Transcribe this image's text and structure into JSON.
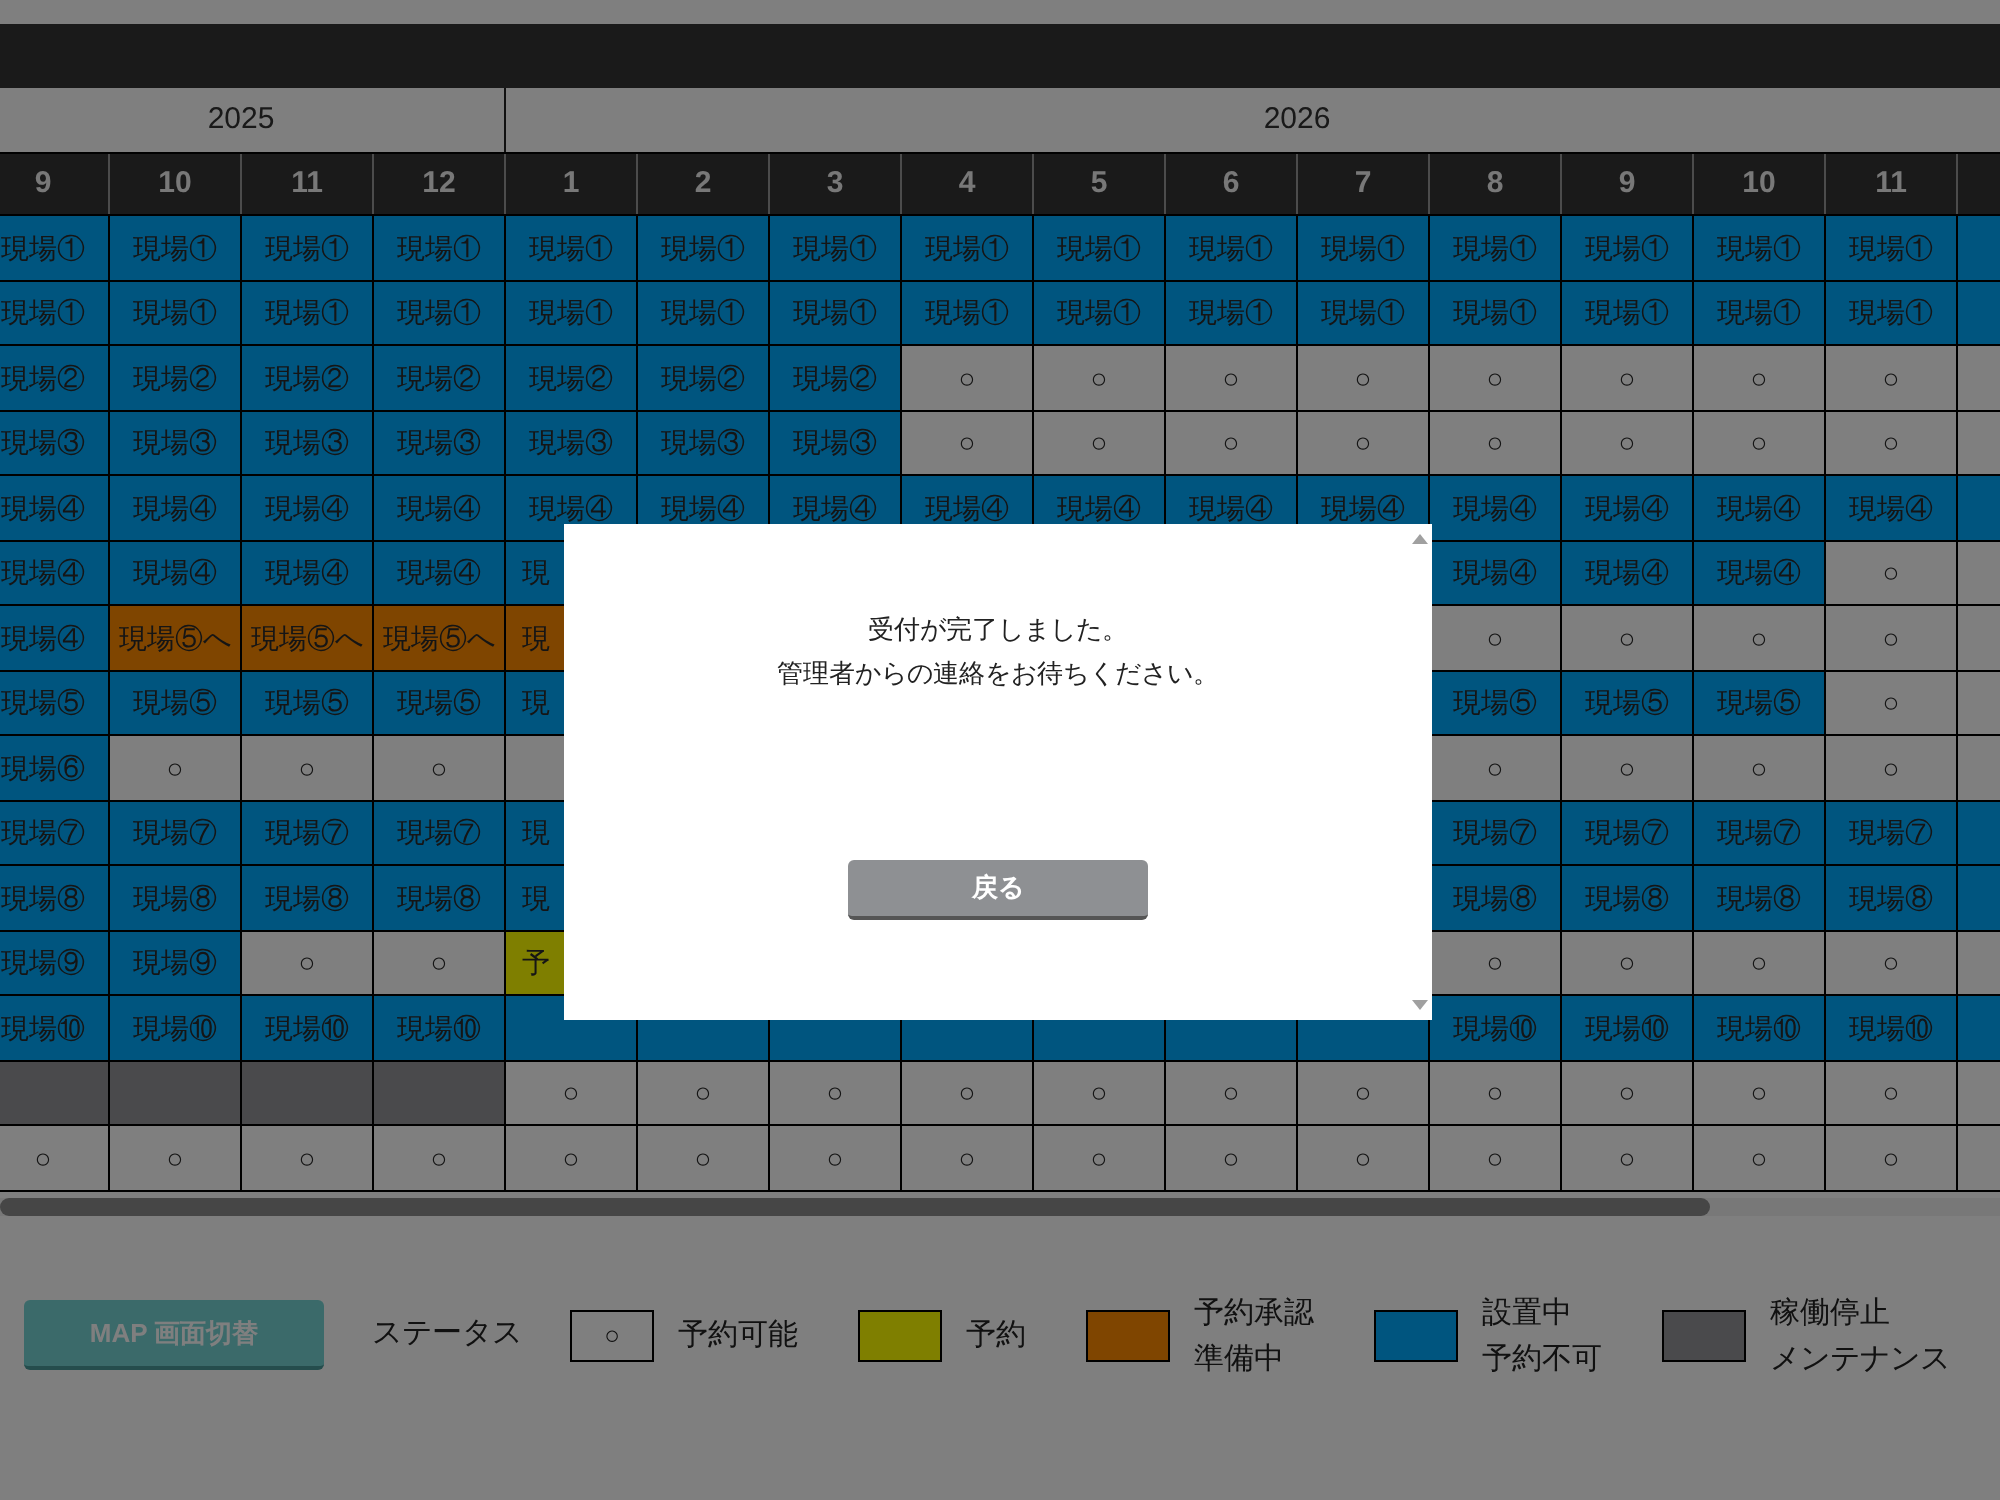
{
  "years": [
    {
      "year": "2025",
      "months": [
        "9",
        "10",
        "11",
        "12"
      ]
    },
    {
      "year": "2026",
      "months": [
        "1",
        "2",
        "3",
        "4",
        "5",
        "6",
        "7",
        "8",
        "9",
        "10",
        "11"
      ]
    }
  ],
  "rows": [
    [
      {
        "kind": "installed",
        "text": "現場①"
      },
      {
        "kind": "installed",
        "text": "現場①"
      },
      {
        "kind": "installed",
        "text": "現場①"
      },
      {
        "kind": "installed",
        "text": "現場①"
      },
      {
        "kind": "installed",
        "text": "現場①"
      },
      {
        "kind": "installed",
        "text": "現場①"
      },
      {
        "kind": "installed",
        "text": "現場①"
      },
      {
        "kind": "installed",
        "text": "現場①"
      },
      {
        "kind": "installed",
        "text": "現場①"
      },
      {
        "kind": "installed",
        "text": "現場①"
      },
      {
        "kind": "installed",
        "text": "現場①"
      },
      {
        "kind": "installed",
        "text": "現場①"
      },
      {
        "kind": "installed",
        "text": "現場①"
      },
      {
        "kind": "installed",
        "text": "現場①"
      },
      {
        "kind": "installed",
        "text": "現場①"
      },
      {
        "kind": "installed"
      }
    ],
    [
      {
        "kind": "installed",
        "text": "現場①"
      },
      {
        "kind": "installed",
        "text": "現場①"
      },
      {
        "kind": "installed",
        "text": "現場①"
      },
      {
        "kind": "installed",
        "text": "現場①"
      },
      {
        "kind": "installed",
        "text": "現場①"
      },
      {
        "kind": "installed",
        "text": "現場①"
      },
      {
        "kind": "installed",
        "text": "現場①"
      },
      {
        "kind": "installed",
        "text": "現場①"
      },
      {
        "kind": "installed",
        "text": "現場①"
      },
      {
        "kind": "installed",
        "text": "現場①"
      },
      {
        "kind": "installed",
        "text": "現場①"
      },
      {
        "kind": "installed",
        "text": "現場①"
      },
      {
        "kind": "installed",
        "text": "現場①"
      },
      {
        "kind": "installed",
        "text": "現場①"
      },
      {
        "kind": "installed",
        "text": "現場①"
      },
      {
        "kind": "installed"
      }
    ],
    [
      {
        "kind": "installed",
        "text": "現場②"
      },
      {
        "kind": "installed",
        "text": "現場②"
      },
      {
        "kind": "installed",
        "text": "現場②"
      },
      {
        "kind": "installed",
        "text": "現場②"
      },
      {
        "kind": "installed",
        "text": "現場②"
      },
      {
        "kind": "installed",
        "text": "現場②"
      },
      {
        "kind": "installed",
        "text": "現場②"
      },
      {
        "kind": "available",
        "text": "○"
      },
      {
        "kind": "available",
        "text": "○"
      },
      {
        "kind": "available",
        "text": "○"
      },
      {
        "kind": "available",
        "text": "○"
      },
      {
        "kind": "available",
        "text": "○"
      },
      {
        "kind": "available",
        "text": "○"
      },
      {
        "kind": "available",
        "text": "○"
      },
      {
        "kind": "available",
        "text": "○"
      },
      {
        "kind": "available"
      }
    ],
    [
      {
        "kind": "installed",
        "text": "現場③"
      },
      {
        "kind": "installed",
        "text": "現場③"
      },
      {
        "kind": "installed",
        "text": "現場③"
      },
      {
        "kind": "installed",
        "text": "現場③"
      },
      {
        "kind": "installed",
        "text": "現場③"
      },
      {
        "kind": "installed",
        "text": "現場③"
      },
      {
        "kind": "installed",
        "text": "現場③"
      },
      {
        "kind": "available",
        "text": "○"
      },
      {
        "kind": "available",
        "text": "○"
      },
      {
        "kind": "available",
        "text": "○"
      },
      {
        "kind": "available",
        "text": "○"
      },
      {
        "kind": "available",
        "text": "○"
      },
      {
        "kind": "available",
        "text": "○"
      },
      {
        "kind": "available",
        "text": "○"
      },
      {
        "kind": "available",
        "text": "○"
      },
      {
        "kind": "available"
      }
    ],
    [
      {
        "kind": "installed",
        "text": "現場④"
      },
      {
        "kind": "installed",
        "text": "現場④"
      },
      {
        "kind": "installed",
        "text": "現場④"
      },
      {
        "kind": "installed",
        "text": "現場④"
      },
      {
        "kind": "installed",
        "text": "現場④"
      },
      {
        "kind": "installed",
        "text": "現場④"
      },
      {
        "kind": "installed",
        "text": "現場④"
      },
      {
        "kind": "installed",
        "text": "現場④"
      },
      {
        "kind": "installed",
        "text": "現場④"
      },
      {
        "kind": "installed",
        "text": "現場④"
      },
      {
        "kind": "installed",
        "text": "現場④"
      },
      {
        "kind": "installed",
        "text": "現場④"
      },
      {
        "kind": "installed",
        "text": "現場④"
      },
      {
        "kind": "installed",
        "text": "現場④"
      },
      {
        "kind": "installed",
        "text": "現場④"
      },
      {
        "kind": "installed"
      }
    ],
    [
      {
        "kind": "installed",
        "text": "現場④"
      },
      {
        "kind": "installed",
        "text": "現場④"
      },
      {
        "kind": "installed",
        "text": "現場④"
      },
      {
        "kind": "installed",
        "text": "現場④"
      },
      {
        "kind": "installed",
        "text": "現",
        "partial": true
      },
      {
        "kind": "hidden"
      },
      {
        "kind": "hidden"
      },
      {
        "kind": "hidden"
      },
      {
        "kind": "hidden"
      },
      {
        "kind": "hidden"
      },
      {
        "kind": "hidden"
      },
      {
        "kind": "installed",
        "text": "現場④"
      },
      {
        "kind": "installed",
        "text": "現場④"
      },
      {
        "kind": "installed",
        "text": "現場④"
      },
      {
        "kind": "available",
        "text": "○"
      },
      {
        "kind": "available"
      }
    ],
    [
      {
        "kind": "installed",
        "text": "現場④"
      },
      {
        "kind": "pending",
        "text": "現場⑤へ"
      },
      {
        "kind": "pending",
        "text": "現場⑤へ"
      },
      {
        "kind": "pending",
        "text": "現場⑤へ"
      },
      {
        "kind": "pending",
        "text": "現",
        "partial": true
      },
      {
        "kind": "hidden"
      },
      {
        "kind": "hidden"
      },
      {
        "kind": "hidden"
      },
      {
        "kind": "hidden"
      },
      {
        "kind": "hidden"
      },
      {
        "kind": "hidden"
      },
      {
        "kind": "available",
        "text": "○"
      },
      {
        "kind": "available",
        "text": "○"
      },
      {
        "kind": "available",
        "text": "○"
      },
      {
        "kind": "available",
        "text": "○"
      },
      {
        "kind": "available"
      }
    ],
    [
      {
        "kind": "installed",
        "text": "現場⑤"
      },
      {
        "kind": "installed",
        "text": "現場⑤"
      },
      {
        "kind": "installed",
        "text": "現場⑤"
      },
      {
        "kind": "installed",
        "text": "現場⑤"
      },
      {
        "kind": "installed",
        "text": "現",
        "partial": true
      },
      {
        "kind": "hidden"
      },
      {
        "kind": "hidden"
      },
      {
        "kind": "hidden"
      },
      {
        "kind": "hidden"
      },
      {
        "kind": "hidden"
      },
      {
        "kind": "hidden"
      },
      {
        "kind": "installed",
        "text": "現場⑤"
      },
      {
        "kind": "installed",
        "text": "現場⑤"
      },
      {
        "kind": "installed",
        "text": "現場⑤"
      },
      {
        "kind": "available",
        "text": "○"
      },
      {
        "kind": "available"
      }
    ],
    [
      {
        "kind": "installed",
        "text": "現場⑥"
      },
      {
        "kind": "available",
        "text": "○"
      },
      {
        "kind": "available",
        "text": "○"
      },
      {
        "kind": "available",
        "text": "○"
      },
      {
        "kind": "available"
      },
      {
        "kind": "hidden"
      },
      {
        "kind": "hidden"
      },
      {
        "kind": "hidden"
      },
      {
        "kind": "hidden"
      },
      {
        "kind": "hidden"
      },
      {
        "kind": "hidden"
      },
      {
        "kind": "available",
        "text": "○"
      },
      {
        "kind": "available",
        "text": "○"
      },
      {
        "kind": "available",
        "text": "○"
      },
      {
        "kind": "available",
        "text": "○"
      },
      {
        "kind": "available"
      }
    ],
    [
      {
        "kind": "installed",
        "text": "現場⑦"
      },
      {
        "kind": "installed",
        "text": "現場⑦"
      },
      {
        "kind": "installed",
        "text": "現場⑦"
      },
      {
        "kind": "installed",
        "text": "現場⑦"
      },
      {
        "kind": "installed",
        "text": "現",
        "partial": true
      },
      {
        "kind": "hidden"
      },
      {
        "kind": "hidden"
      },
      {
        "kind": "hidden"
      },
      {
        "kind": "hidden"
      },
      {
        "kind": "hidden"
      },
      {
        "kind": "hidden"
      },
      {
        "kind": "installed",
        "text": "現場⑦"
      },
      {
        "kind": "installed",
        "text": "現場⑦"
      },
      {
        "kind": "installed",
        "text": "現場⑦"
      },
      {
        "kind": "installed",
        "text": "現場⑦"
      },
      {
        "kind": "installed"
      }
    ],
    [
      {
        "kind": "installed",
        "text": "現場⑧"
      },
      {
        "kind": "installed",
        "text": "現場⑧"
      },
      {
        "kind": "installed",
        "text": "現場⑧"
      },
      {
        "kind": "installed",
        "text": "現場⑧"
      },
      {
        "kind": "installed",
        "text": "現",
        "partial": true
      },
      {
        "kind": "hidden"
      },
      {
        "kind": "hidden"
      },
      {
        "kind": "hidden"
      },
      {
        "kind": "hidden"
      },
      {
        "kind": "hidden"
      },
      {
        "kind": "hidden"
      },
      {
        "kind": "installed",
        "text": "現場⑧"
      },
      {
        "kind": "installed",
        "text": "現場⑧"
      },
      {
        "kind": "installed",
        "text": "現場⑧"
      },
      {
        "kind": "installed",
        "text": "現場⑧"
      },
      {
        "kind": "installed"
      }
    ],
    [
      {
        "kind": "installed",
        "text": "現場⑨"
      },
      {
        "kind": "installed",
        "text": "現場⑨"
      },
      {
        "kind": "available",
        "text": "○"
      },
      {
        "kind": "available",
        "text": "○"
      },
      {
        "kind": "reserved",
        "text": "予",
        "partial": true
      },
      {
        "kind": "hidden"
      },
      {
        "kind": "hidden"
      },
      {
        "kind": "hidden"
      },
      {
        "kind": "hidden"
      },
      {
        "kind": "hidden"
      },
      {
        "kind": "hidden"
      },
      {
        "kind": "available",
        "text": "○"
      },
      {
        "kind": "available",
        "text": "○"
      },
      {
        "kind": "available",
        "text": "○"
      },
      {
        "kind": "available",
        "text": "○"
      },
      {
        "kind": "available"
      }
    ],
    [
      {
        "kind": "installed",
        "text": "現場⑩"
      },
      {
        "kind": "installed",
        "text": "現場⑩"
      },
      {
        "kind": "installed",
        "text": "現場⑩"
      },
      {
        "kind": "installed",
        "text": "現場⑩"
      },
      {
        "kind": "installed"
      },
      {
        "kind": "installed"
      },
      {
        "kind": "installed"
      },
      {
        "kind": "installed"
      },
      {
        "kind": "installed"
      },
      {
        "kind": "installed"
      },
      {
        "kind": "installed"
      },
      {
        "kind": "installed",
        "text": "現場⑩"
      },
      {
        "kind": "installed",
        "text": "現場⑩"
      },
      {
        "kind": "installed",
        "text": "現場⑩"
      },
      {
        "kind": "installed",
        "text": "現場⑩"
      },
      {
        "kind": "installed"
      }
    ],
    [
      {
        "kind": "maintenance"
      },
      {
        "kind": "maintenance"
      },
      {
        "kind": "maintenance"
      },
      {
        "kind": "maintenance"
      },
      {
        "kind": "available",
        "text": "○"
      },
      {
        "kind": "available",
        "text": "○"
      },
      {
        "kind": "available",
        "text": "○"
      },
      {
        "kind": "available",
        "text": "○"
      },
      {
        "kind": "available",
        "text": "○"
      },
      {
        "kind": "available",
        "text": "○"
      },
      {
        "kind": "available",
        "text": "○"
      },
      {
        "kind": "available",
        "text": "○"
      },
      {
        "kind": "available",
        "text": "○"
      },
      {
        "kind": "available",
        "text": "○"
      },
      {
        "kind": "available",
        "text": "○"
      },
      {
        "kind": "available"
      }
    ],
    [
      {
        "kind": "available",
        "text": "○"
      },
      {
        "kind": "available",
        "text": "○"
      },
      {
        "kind": "available",
        "text": "○"
      },
      {
        "kind": "available",
        "text": "○"
      },
      {
        "kind": "available",
        "text": "○"
      },
      {
        "kind": "available",
        "text": "○"
      },
      {
        "kind": "available",
        "text": "○"
      },
      {
        "kind": "available",
        "text": "○"
      },
      {
        "kind": "available",
        "text": "○"
      },
      {
        "kind": "available",
        "text": "○"
      },
      {
        "kind": "available",
        "text": "○"
      },
      {
        "kind": "available",
        "text": "○"
      },
      {
        "kind": "available",
        "text": "○"
      },
      {
        "kind": "available",
        "text": "○"
      },
      {
        "kind": "available",
        "text": "○"
      },
      {
        "kind": "available"
      }
    ]
  ],
  "map_button": "MAP 画面切替",
  "legend": {
    "title": "ステータス",
    "items": [
      {
        "kind": "available",
        "swatch_text": "○",
        "label": [
          "予約可能"
        ]
      },
      {
        "kind": "reserved",
        "label": [
          "予約"
        ]
      },
      {
        "kind": "pending",
        "label": [
          "予約承認",
          "準備中"
        ]
      },
      {
        "kind": "installed",
        "label": [
          "設置中",
          "予約不可"
        ]
      },
      {
        "kind": "maintenance",
        "label": [
          "稼働停止",
          "メンテナンス"
        ]
      }
    ]
  },
  "dialog": {
    "message": [
      "受付が完了しました。",
      "管理者からの連絡をお待ちください。"
    ],
    "button": "戻る"
  }
}
